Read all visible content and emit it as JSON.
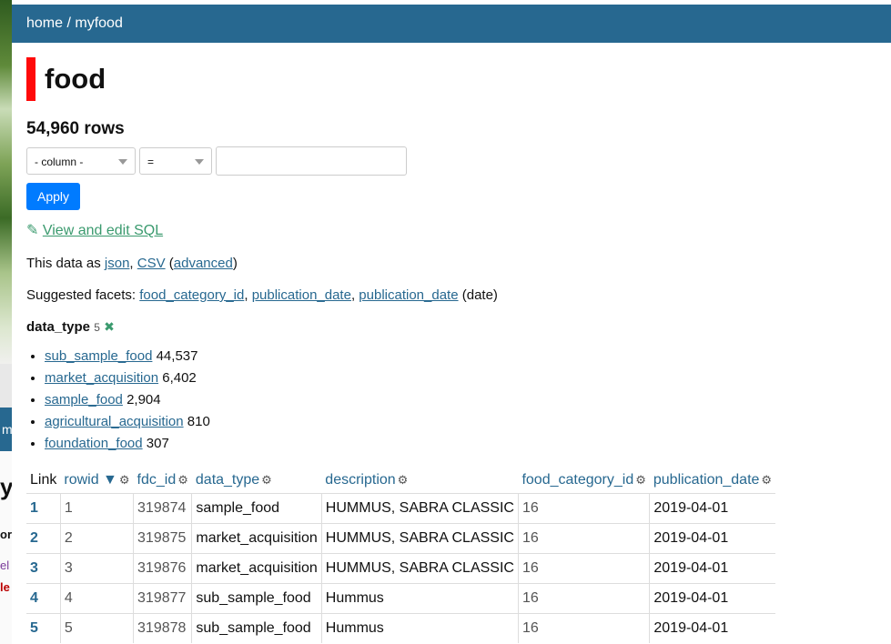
{
  "breadcrumb": {
    "home": "home",
    "separator": " / ",
    "db": "myfood"
  },
  "table_name": "food",
  "row_count": "54,960 rows",
  "filter": {
    "column_select": "- column -",
    "op_select": "=",
    "value": "",
    "apply_label": "Apply"
  },
  "sql_link": {
    "icon": "✎",
    "label": "View and edit SQL"
  },
  "export": {
    "prefix": "This data as ",
    "json": "json",
    "sep": ", ",
    "csv": "CSV",
    "open": " (",
    "advanced": "advanced",
    "close": ")"
  },
  "suggested": {
    "prefix": "Suggested facets: ",
    "items": [
      "food_category_id",
      "publication_date",
      "publication_date"
    ],
    "suffix": " (date)"
  },
  "facet": {
    "name": "data_type",
    "count": "5",
    "remove_icon": "✖",
    "items": [
      {
        "label": "sub_sample_food",
        "count": "44,537"
      },
      {
        "label": "market_acquisition",
        "count": "6,402"
      },
      {
        "label": "sample_food",
        "count": "2,904"
      },
      {
        "label": "agricultural_acquisition",
        "count": "810"
      },
      {
        "label": "foundation_food",
        "count": "307"
      }
    ]
  },
  "columns": {
    "link": "Link",
    "rowid": "rowid ▼",
    "fdc_id": "fdc_id",
    "data_type": "data_type",
    "description": "description",
    "food_category_id": "food_category_id",
    "publication_date": "publication_date",
    "gear_icon": "⚙"
  },
  "rows": [
    {
      "link": "1",
      "rowid": "1",
      "fdc_id": "319874",
      "data_type": "sample_food",
      "description": "HUMMUS, SABRA CLASSIC",
      "food_category_id": "16",
      "publication_date": "2019-04-01"
    },
    {
      "link": "2",
      "rowid": "2",
      "fdc_id": "319875",
      "data_type": "market_acquisition",
      "description": "HUMMUS, SABRA CLASSIC",
      "food_category_id": "16",
      "publication_date": "2019-04-01"
    },
    {
      "link": "3",
      "rowid": "3",
      "fdc_id": "319876",
      "data_type": "market_acquisition",
      "description": "HUMMUS, SABRA CLASSIC",
      "food_category_id": "16",
      "publication_date": "2019-04-01"
    },
    {
      "link": "4",
      "rowid": "4",
      "fdc_id": "319877",
      "data_type": "sub_sample_food",
      "description": "Hummus",
      "food_category_id": "16",
      "publication_date": "2019-04-01"
    },
    {
      "link": "5",
      "rowid": "5",
      "fdc_id": "319878",
      "data_type": "sub_sample_food",
      "description": "Hummus",
      "food_category_id": "16",
      "publication_date": "2019-04-01"
    }
  ],
  "background_fragments": {
    "blue_tab": "m",
    "a": "y",
    "b": "or",
    "c": "el",
    "d": "le"
  }
}
